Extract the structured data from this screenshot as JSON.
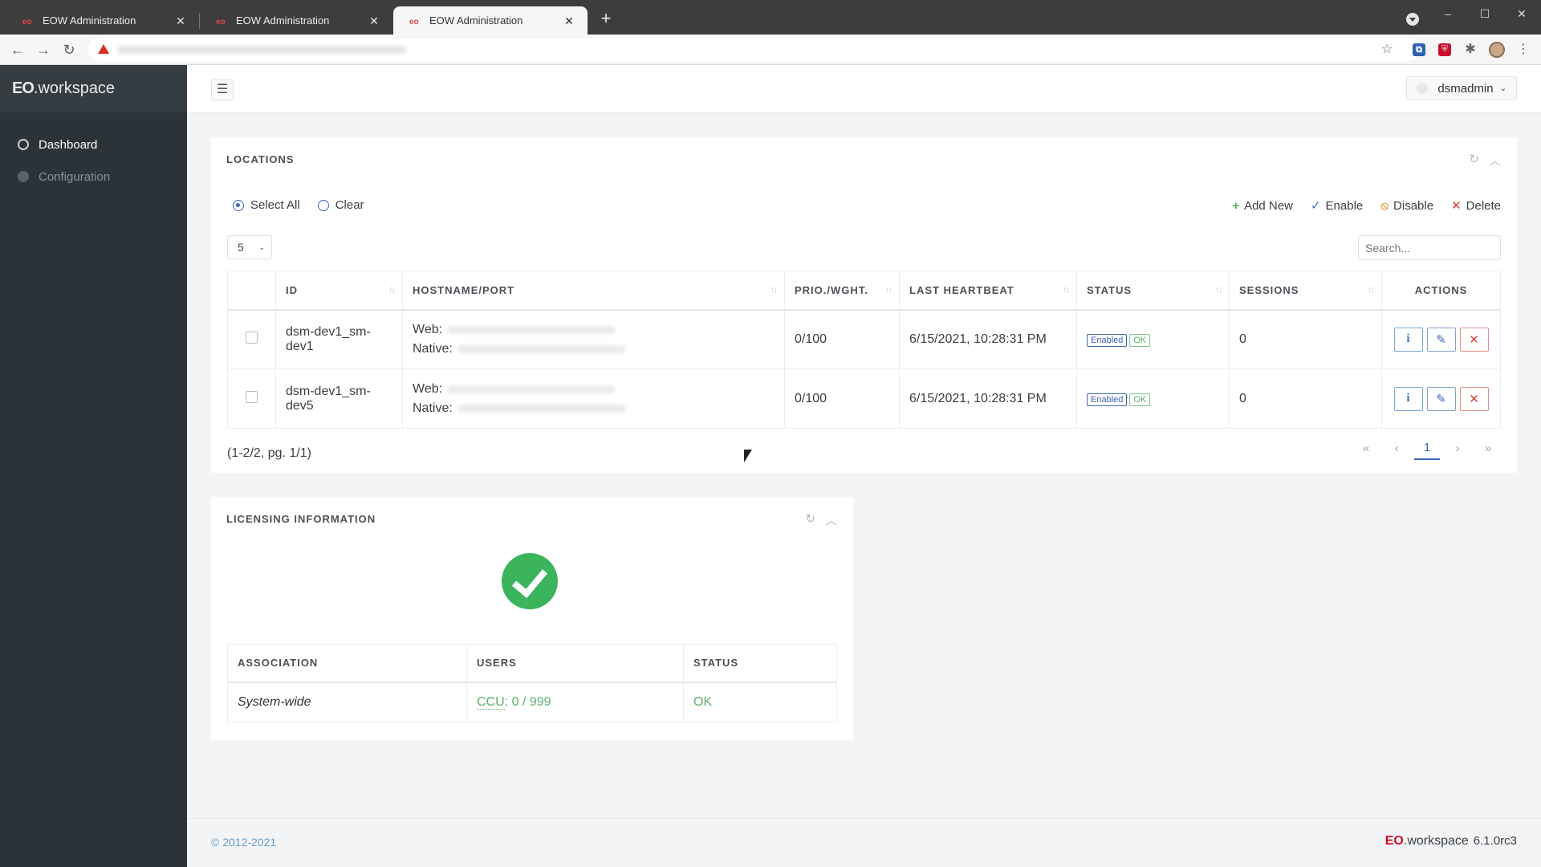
{
  "browser": {
    "tabs": [
      {
        "title": "EOW Administration",
        "close": "✕"
      },
      {
        "title": "EOW Administration",
        "close": "✕"
      },
      {
        "title": "EOW Administration",
        "close": "✕"
      }
    ],
    "new_tab": "+",
    "window_controls": {
      "minimize": "–",
      "maximize": "☐",
      "close": "✕"
    },
    "nav": {
      "back": "←",
      "forward": "→",
      "reload": "↻"
    },
    "toolbar_icons": {
      "bookmark": "☆",
      "ext_a": "⧉",
      "ext_b": "⛨",
      "extensions": "✱",
      "menu": "⋮"
    }
  },
  "sidebar": {
    "brand_mark": "EO",
    "brand_name": ".workspace",
    "items": [
      {
        "label": "Dashboard",
        "active": true
      },
      {
        "label": "Configuration",
        "active": false
      }
    ]
  },
  "topbar": {
    "menu_icon": "☰",
    "user": "dsmadmin",
    "caret": "⌄"
  },
  "locations": {
    "title": "LOCATIONS",
    "tool_icons": {
      "refresh": "↻",
      "collapse": "︿"
    },
    "select_all": "Select All",
    "clear": "Clear",
    "actions": [
      {
        "icon": "+",
        "label": "Add New"
      },
      {
        "icon": "✓",
        "label": "Enable"
      },
      {
        "icon": "⦸",
        "label": "Disable"
      },
      {
        "icon": "✕",
        "label": "Delete"
      }
    ],
    "page_size": "5",
    "page_size_caret": "⌄",
    "search_placeholder": "Search...",
    "sort_icon": "↑↓",
    "columns": [
      "ID",
      "HOSTNAME/PORT",
      "PRIO./WGHT.",
      "LAST HEARTBEAT",
      "STATUS",
      "SESSIONS",
      "ACTIONS"
    ],
    "rows": [
      {
        "id_line1": "dsm-dev1_sm-",
        "id_line2": "dev1",
        "web": "Web:",
        "native": "Native:",
        "prio": "0/100",
        "heartbeat": "6/15/2021, 10:28:31 PM",
        "status": "Enabled",
        "health": "OK",
        "sessions": "0"
      },
      {
        "id_line1": "dsm-dev1_sm-",
        "id_line2": "dev5",
        "web": "Web:",
        "native": "Native:",
        "prio": "0/100",
        "heartbeat": "6/15/2021, 10:28:31 PM",
        "status": "Enabled",
        "health": "OK",
        "sessions": "0"
      }
    ],
    "row_action_icons": {
      "info": "i",
      "edit": "✎",
      "delete": "✕"
    },
    "summary": "(1-2/2, pg. 1/1)",
    "pager": {
      "first": "«",
      "prev": "‹",
      "current": "1",
      "next": "›",
      "last": "»"
    }
  },
  "licensing": {
    "title": "LICENSING INFORMATION",
    "tool_icons": {
      "refresh": "↻",
      "collapse": "︿"
    },
    "columns": [
      "ASSOCIATION",
      "USERS",
      "STATUS"
    ],
    "rows": [
      {
        "association": "System-wide",
        "users_abbr": "CCU",
        "users_value": ": 0 / 999",
        "status": "OK"
      }
    ]
  },
  "footer": {
    "copyright": "© 2012-2021",
    "brand_mark": "EO",
    "brand_name": ".workspace",
    "version": "6.1.0rc3"
  },
  "colors": {
    "sidebar_bg": "#2c3338",
    "accent_blue": "#3e66b8",
    "success_green": "#3cb45b",
    "danger_red": "#d9443c"
  }
}
